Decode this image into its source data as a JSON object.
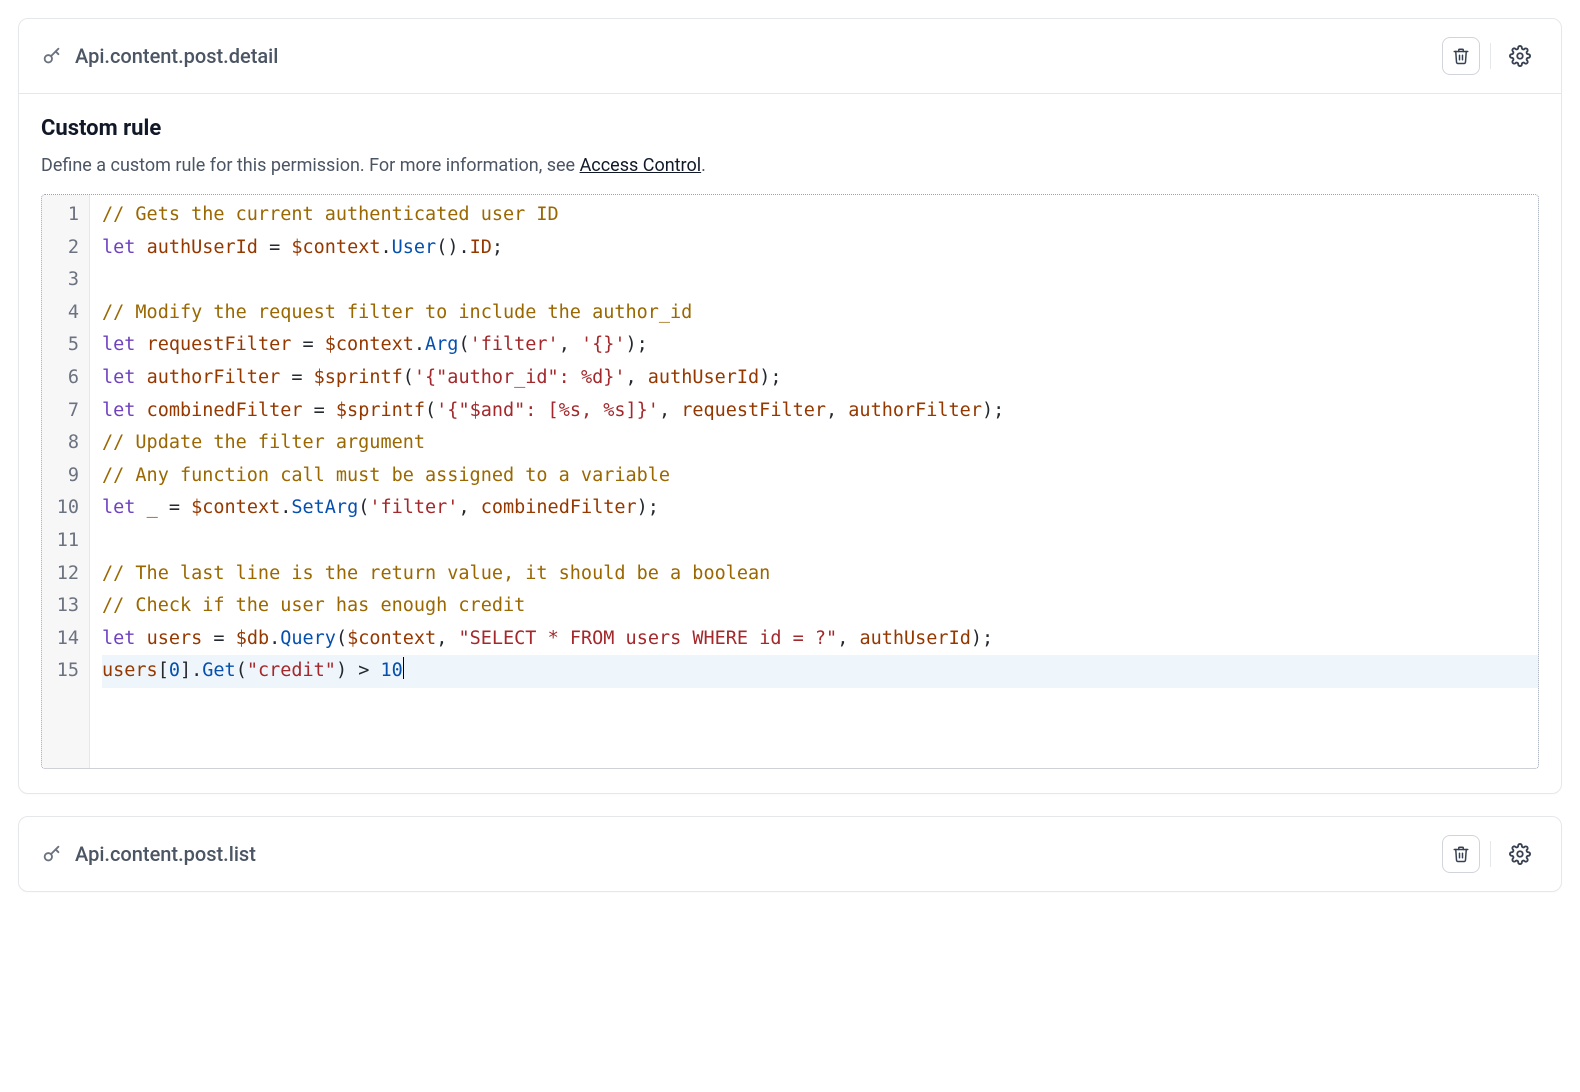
{
  "panels": [
    {
      "id": "detail",
      "title": "Api.content.post.detail",
      "expanded": true
    },
    {
      "id": "list",
      "title": "Api.content.post.list",
      "expanded": false
    }
  ],
  "section": {
    "heading": "Custom rule",
    "subtitle_prefix": "Define a custom rule for this permission. For more information, see ",
    "subtitle_link": "Access Control",
    "subtitle_suffix": "."
  },
  "code": {
    "active_line": 15,
    "lines": [
      {
        "n": 1,
        "tokens": [
          {
            "t": "comment",
            "v": "// Gets the current authenticated user ID"
          }
        ]
      },
      {
        "n": 2,
        "tokens": [
          {
            "t": "keyword",
            "v": "let"
          },
          {
            "t": "plain",
            "v": " "
          },
          {
            "t": "ident",
            "v": "authUserId"
          },
          {
            "t": "plain",
            "v": " "
          },
          {
            "t": "op",
            "v": "="
          },
          {
            "t": "plain",
            "v": " "
          },
          {
            "t": "ident",
            "v": "$context"
          },
          {
            "t": "plain",
            "v": "."
          },
          {
            "t": "func",
            "v": "User"
          },
          {
            "t": "plain",
            "v": "()."
          },
          {
            "t": "ident",
            "v": "ID"
          },
          {
            "t": "plain",
            "v": ";"
          }
        ]
      },
      {
        "n": 3,
        "tokens": []
      },
      {
        "n": 4,
        "tokens": [
          {
            "t": "comment",
            "v": "// Modify the request filter to include the author_id"
          }
        ]
      },
      {
        "n": 5,
        "tokens": [
          {
            "t": "keyword",
            "v": "let"
          },
          {
            "t": "plain",
            "v": " "
          },
          {
            "t": "ident",
            "v": "requestFilter"
          },
          {
            "t": "plain",
            "v": " "
          },
          {
            "t": "op",
            "v": "="
          },
          {
            "t": "plain",
            "v": " "
          },
          {
            "t": "ident",
            "v": "$context"
          },
          {
            "t": "plain",
            "v": "."
          },
          {
            "t": "func",
            "v": "Arg"
          },
          {
            "t": "plain",
            "v": "("
          },
          {
            "t": "string",
            "v": "'filter'"
          },
          {
            "t": "plain",
            "v": ", "
          },
          {
            "t": "string",
            "v": "'{}'"
          },
          {
            "t": "plain",
            "v": ");"
          }
        ]
      },
      {
        "n": 6,
        "tokens": [
          {
            "t": "keyword",
            "v": "let"
          },
          {
            "t": "plain",
            "v": " "
          },
          {
            "t": "ident",
            "v": "authorFilter"
          },
          {
            "t": "plain",
            "v": " "
          },
          {
            "t": "op",
            "v": "="
          },
          {
            "t": "plain",
            "v": " "
          },
          {
            "t": "ident",
            "v": "$sprintf"
          },
          {
            "t": "plain",
            "v": "("
          },
          {
            "t": "string",
            "v": "'{\"author_id\": %d}'"
          },
          {
            "t": "plain",
            "v": ", "
          },
          {
            "t": "ident",
            "v": "authUserId"
          },
          {
            "t": "plain",
            "v": ");"
          }
        ]
      },
      {
        "n": 7,
        "tokens": [
          {
            "t": "keyword",
            "v": "let"
          },
          {
            "t": "plain",
            "v": " "
          },
          {
            "t": "ident",
            "v": "combinedFilter"
          },
          {
            "t": "plain",
            "v": " "
          },
          {
            "t": "op",
            "v": "="
          },
          {
            "t": "plain",
            "v": " "
          },
          {
            "t": "ident",
            "v": "$sprintf"
          },
          {
            "t": "plain",
            "v": "("
          },
          {
            "t": "string",
            "v": "'{\"$and\": [%s, %s]}'"
          },
          {
            "t": "plain",
            "v": ", "
          },
          {
            "t": "ident",
            "v": "requestFilter"
          },
          {
            "t": "plain",
            "v": ", "
          },
          {
            "t": "ident",
            "v": "authorFilter"
          },
          {
            "t": "plain",
            "v": ");"
          }
        ]
      },
      {
        "n": 8,
        "tokens": [
          {
            "t": "comment",
            "v": "// Update the filter argument"
          }
        ]
      },
      {
        "n": 9,
        "tokens": [
          {
            "t": "comment",
            "v": "// Any function call must be assigned to a variable"
          }
        ]
      },
      {
        "n": 10,
        "tokens": [
          {
            "t": "keyword",
            "v": "let"
          },
          {
            "t": "plain",
            "v": " "
          },
          {
            "t": "ident",
            "v": "_"
          },
          {
            "t": "plain",
            "v": " "
          },
          {
            "t": "op",
            "v": "="
          },
          {
            "t": "plain",
            "v": " "
          },
          {
            "t": "ident",
            "v": "$context"
          },
          {
            "t": "plain",
            "v": "."
          },
          {
            "t": "func",
            "v": "SetArg"
          },
          {
            "t": "plain",
            "v": "("
          },
          {
            "t": "string",
            "v": "'filter'"
          },
          {
            "t": "plain",
            "v": ", "
          },
          {
            "t": "ident",
            "v": "combinedFilter"
          },
          {
            "t": "plain",
            "v": ");"
          }
        ]
      },
      {
        "n": 11,
        "tokens": []
      },
      {
        "n": 12,
        "tokens": [
          {
            "t": "comment",
            "v": "// The last line is the return value, it should be a boolean"
          }
        ]
      },
      {
        "n": 13,
        "tokens": [
          {
            "t": "comment",
            "v": "// Check if the user has enough credit"
          }
        ]
      },
      {
        "n": 14,
        "tokens": [
          {
            "t": "keyword",
            "v": "let"
          },
          {
            "t": "plain",
            "v": " "
          },
          {
            "t": "ident",
            "v": "users"
          },
          {
            "t": "plain",
            "v": " "
          },
          {
            "t": "op",
            "v": "="
          },
          {
            "t": "plain",
            "v": " "
          },
          {
            "t": "ident",
            "v": "$db"
          },
          {
            "t": "plain",
            "v": "."
          },
          {
            "t": "func",
            "v": "Query"
          },
          {
            "t": "plain",
            "v": "("
          },
          {
            "t": "ident",
            "v": "$context"
          },
          {
            "t": "plain",
            "v": ", "
          },
          {
            "t": "string",
            "v": "\"SELECT * FROM users WHERE id = ?\""
          },
          {
            "t": "plain",
            "v": ", "
          },
          {
            "t": "ident",
            "v": "authUserId"
          },
          {
            "t": "plain",
            "v": ");"
          }
        ]
      },
      {
        "n": 15,
        "tokens": [
          {
            "t": "ident",
            "v": "users"
          },
          {
            "t": "plain",
            "v": "["
          },
          {
            "t": "num",
            "v": "0"
          },
          {
            "t": "plain",
            "v": "]."
          },
          {
            "t": "func",
            "v": "Get"
          },
          {
            "t": "plain",
            "v": "("
          },
          {
            "t": "string",
            "v": "\"credit\""
          },
          {
            "t": "plain",
            "v": ") "
          },
          {
            "t": "op",
            "v": ">"
          },
          {
            "t": "plain",
            "v": " "
          },
          {
            "t": "num",
            "v": "10"
          }
        ]
      }
    ]
  }
}
